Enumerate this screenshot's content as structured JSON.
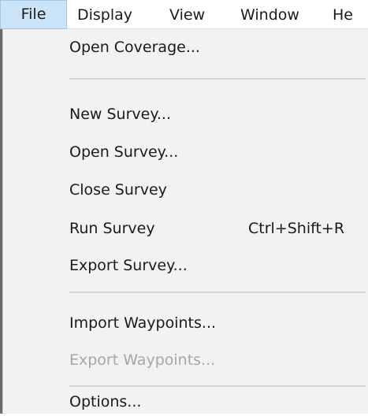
{
  "menubar": {
    "items": [
      {
        "label": "File"
      },
      {
        "label": "Display"
      },
      {
        "label": "View"
      },
      {
        "label": "Window"
      },
      {
        "label": "He"
      }
    ]
  },
  "file_menu": {
    "open_coverage": "Open Coverage...",
    "new_survey": "New Survey...",
    "open_survey": "Open Survey...",
    "close_survey": "Close Survey",
    "run_survey": "Run Survey",
    "run_survey_shortcut": "Ctrl+Shift+R",
    "export_survey": "Export Survey...",
    "import_waypoints": "Import Waypoints...",
    "export_waypoints": "Export Waypoints...",
    "options": "Options..."
  },
  "colors": {
    "active_menu_bg": "#cce4f7",
    "active_menu_border": "#99c9ef",
    "dropdown_bg": "#f2f2f2",
    "disabled_text": "#a6a6a6"
  }
}
